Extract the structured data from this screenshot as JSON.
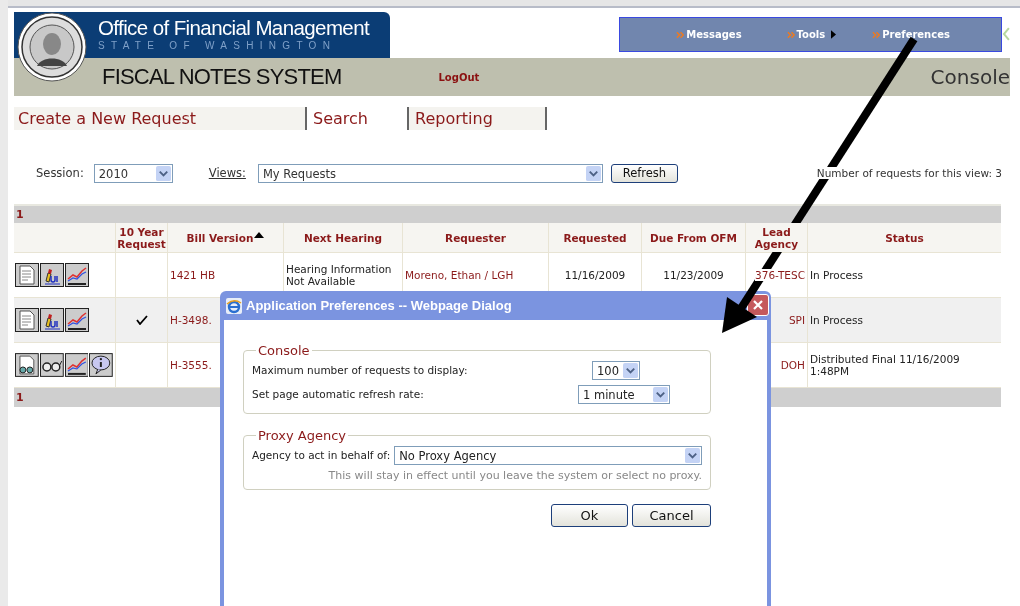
{
  "header": {
    "title": "Office of Financial Management",
    "subtitle": "STATE OF WASHINGTON",
    "system_name": "FISCAL NOTES SYSTEM",
    "logout": "LogOut",
    "page_title": "Console"
  },
  "top_nav": [
    {
      "label": "Messages",
      "submenu": false
    },
    {
      "label": "Tools",
      "submenu": true
    },
    {
      "label": "Preferences",
      "submenu": false
    }
  ],
  "menu": [
    "Create a New Request",
    "Search",
    "Reporting"
  ],
  "filters": {
    "session_label": "Session:",
    "session": "2010",
    "views_label": "Views:",
    "view": "My Requests",
    "refresh": "Refresh",
    "count": "Number of requests for this view: 3"
  },
  "table": {
    "group_label": "1",
    "footer_label": "1",
    "columns": [
      {
        "label": "10 Year Request",
        "sorted": false
      },
      {
        "label": "Bill Version",
        "sorted": true
      },
      {
        "label": "Next Hearing",
        "sorted": false
      },
      {
        "label": "Requester",
        "sorted": false
      },
      {
        "label": "Requested",
        "sorted": false
      },
      {
        "label": "Due From OFM",
        "sorted": false
      },
      {
        "label": "Lead Agency",
        "sorted": false
      },
      {
        "label": "Status",
        "sorted": false
      }
    ],
    "rows": [
      {
        "actions": [
          {
            "kind": "document"
          },
          {
            "kind": "edit"
          },
          {
            "kind": "chart"
          }
        ],
        "ten_year": false,
        "bill_version": "1421 HB",
        "next_hearing": "Hearing Information Not Available",
        "requester": "Moreno, Ethan / LGH",
        "requested": "11/16/2009",
        "due": "11/23/2009",
        "lead_agency": "376-TESC",
        "status": "In Process"
      },
      {
        "actions": [
          {
            "kind": "document"
          },
          {
            "kind": "edit"
          },
          {
            "kind": "chart"
          }
        ],
        "ten_year": true,
        "bill_version": "H-3498.",
        "lead_agency": "SPI",
        "status": "In Process"
      },
      {
        "actions": [
          {
            "kind": "review"
          },
          {
            "kind": "glasses"
          },
          {
            "kind": "chart"
          },
          {
            "kind": "info"
          }
        ],
        "ten_year": false,
        "bill_version": "H-3555.",
        "lead_agency": "DOH",
        "status": "Distributed Final 11/16/2009 1:48PM"
      }
    ]
  },
  "dialog": {
    "title": "Application Preferences -- Webpage Dialog",
    "sections": [
      {
        "legend": "Console",
        "fields": [
          {
            "label": "Maximum number of requests to display:",
            "value": "100",
            "kind": "narrow"
          },
          {
            "label": "Set page automatic refresh rate:",
            "value": "1 minute",
            "kind": "medium"
          }
        ]
      },
      {
        "legend": "Proxy Agency",
        "fields": [
          {
            "label": "Agency to act in behalf of:",
            "value": "No Proxy Agency",
            "kind": "wide"
          }
        ],
        "note": "This will stay in effect until you leave the system or select no proxy."
      }
    ],
    "buttons": [
      "Ok",
      "Cancel"
    ]
  }
}
